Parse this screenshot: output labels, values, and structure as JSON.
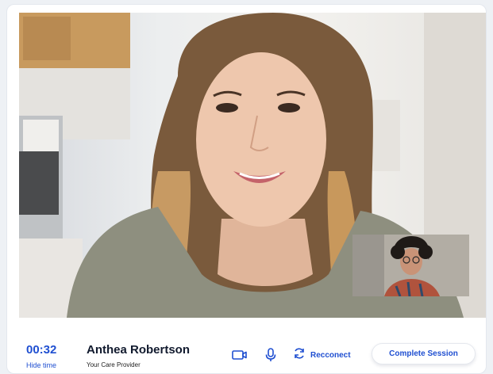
{
  "call": {
    "timer": "00:32",
    "hide_time_label": "Hide time"
  },
  "provider": {
    "name": "Anthea Robertson",
    "role": "Your Care Provider"
  },
  "controls": {
    "camera_icon": "camera-icon",
    "mic_icon": "microphone-icon",
    "reconnect_icon": "refresh-icon",
    "reconnect_label": "Recconect",
    "complete_label": "Complete Session"
  },
  "colors": {
    "accent": "#1f4fd1",
    "name_text": "#111a2e"
  }
}
